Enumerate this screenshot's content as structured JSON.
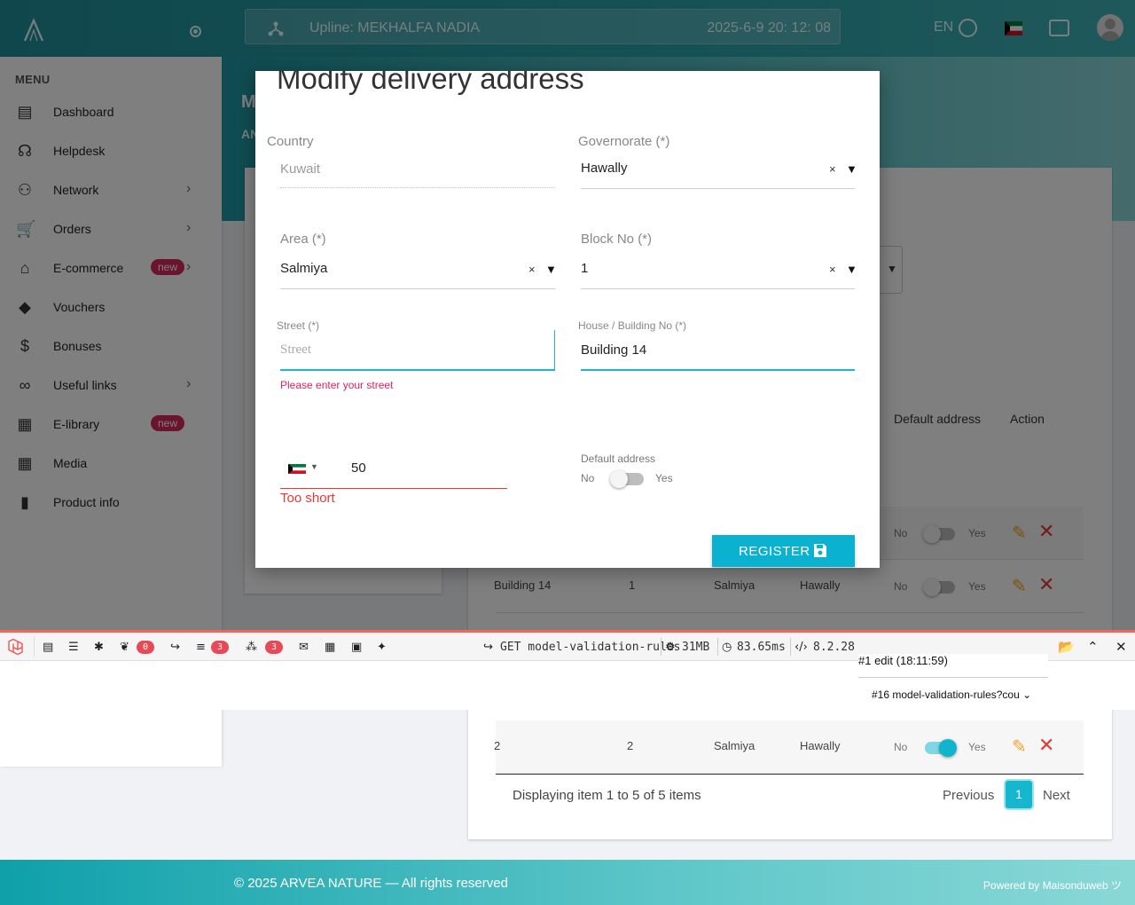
{
  "topbar": {
    "upline": "Upline: MEKHALFA NADIA",
    "datetime": "2025-6-9 20: 12: 08",
    "lang": "EN"
  },
  "sidebar": {
    "menu_title": "MENU",
    "items": [
      {
        "label": "Dashboard",
        "icon": "dashboard-icon",
        "glyph": "▤",
        "chevron": false
      },
      {
        "label": "Helpdesk",
        "icon": "headset-icon",
        "glyph": "☊",
        "chevron": false
      },
      {
        "label": "Network",
        "icon": "people-icon",
        "glyph": "⚇",
        "chevron": true
      },
      {
        "label": "Orders",
        "icon": "cart-icon",
        "glyph": "🛒",
        "chevron": true
      },
      {
        "label": "E-commerce",
        "icon": "store-icon",
        "glyph": "⌂",
        "chevron": true,
        "badge": "new"
      },
      {
        "label": "Vouchers",
        "icon": "voucher-icon",
        "glyph": "◆",
        "chevron": false
      },
      {
        "label": "Bonuses",
        "icon": "dollar-icon",
        "glyph": "$",
        "chevron": false
      },
      {
        "label": "Useful links",
        "icon": "link-icon",
        "glyph": "∞",
        "chevron": true
      },
      {
        "label": "E-library",
        "icon": "library-icon",
        "glyph": "▦",
        "chevron": false,
        "badge": "new"
      },
      {
        "label": "Media",
        "icon": "media-icon",
        "glyph": "▦",
        "chevron": false
      },
      {
        "label": "Product info",
        "icon": "chart-icon",
        "glyph": "▮",
        "chevron": false
      }
    ]
  },
  "hero": {
    "title_peek": "M",
    "sub_peek": "AN"
  },
  "table": {
    "headers": {
      "default": "Default address",
      "action": "Action"
    },
    "rows": [
      {
        "building": "",
        "block": "",
        "area": "",
        "gov": "",
        "no": "No",
        "yes": "Yes",
        "default": false
      },
      {
        "building": "Building 14",
        "block": "1",
        "area": "Salmiya",
        "gov": "Hawally",
        "no": "No",
        "yes": "Yes",
        "default": false
      },
      {
        "building": "2",
        "block": "2",
        "area": "Salmiya",
        "gov": "Hawally",
        "no": "No",
        "yes": "Yes",
        "default": true
      }
    ],
    "pagination": {
      "info": "Displaying item 1 to 5 of 5 items",
      "prev": "Previous",
      "current": "1",
      "next": "Next"
    }
  },
  "modal": {
    "title": "Modify delivery address",
    "country": {
      "label": "Country",
      "value": "Kuwait"
    },
    "governorate": {
      "label": "Governorate (*)",
      "value": "Hawally"
    },
    "area": {
      "label": "Area (*)",
      "value": "Salmiya"
    },
    "block": {
      "label": "Block No (*)",
      "value": "1"
    },
    "street": {
      "label": "Street (*)",
      "placeholder": "Street",
      "error": "Please enter your street"
    },
    "house": {
      "label": "House / Building No (*)",
      "value": "Building 14"
    },
    "phone": {
      "value": "50",
      "error": "Too short"
    },
    "default_address": {
      "label": "Default address",
      "no": "No",
      "yes": "Yes",
      "on": false
    },
    "register": "REGISTER",
    "clear_glyph": "×",
    "caret_glyph": "▼"
  },
  "debugbar": {
    "badges": {
      "logs": "0",
      "queries": "3",
      "models": "3"
    },
    "route": "GET model-validation-rules",
    "memory": "31MB",
    "time": "83.65ms",
    "php": "8.2.28",
    "request1": "#1 edit (18:11:59)",
    "request2": "#16 model-validation-rules?cou"
  },
  "footer": {
    "copyright": "© 2025 ARVEA NATURE — All rights reserved",
    "powered": "Powered by Maisonduweb ツ"
  },
  "colors": {
    "accent": "#0ab2cf",
    "brand_teal": "#1f8f99",
    "error": "#e0245e",
    "badge": "#d6295c",
    "debug_border": "#f4645f"
  }
}
